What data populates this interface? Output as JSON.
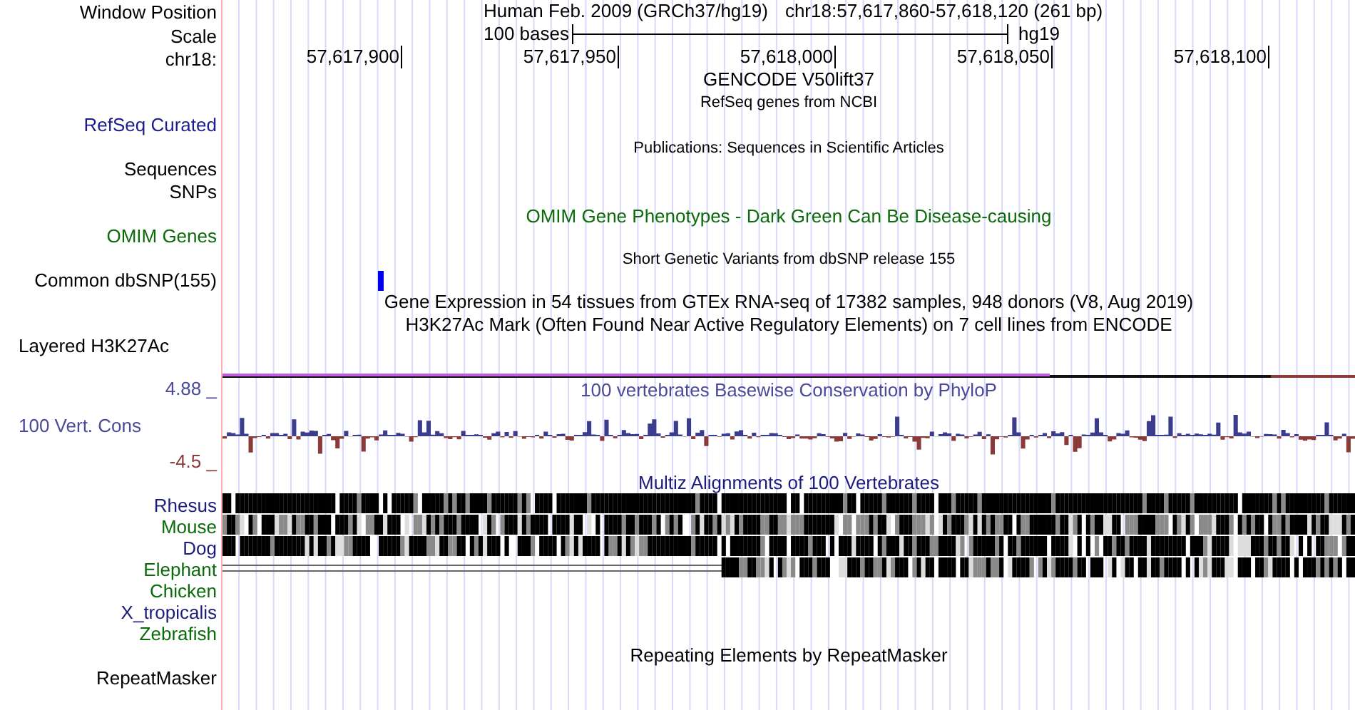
{
  "header": {
    "title": "Human Feb. 2009 (GRCh37/hg19)",
    "position": "chr18:57,617,860-57,618,120 (261 bp)",
    "scale_length": "100 bases",
    "assembly": "hg19",
    "ticks": [
      "57,617,900",
      "57,617,950",
      "57,618,000",
      "57,618,050",
      "57,618,100"
    ]
  },
  "labels": [
    {
      "text": "Window Position",
      "color": "#000000"
    },
    {
      "text": "Scale",
      "color": "#000000"
    },
    {
      "text": "chr18:",
      "color": "#000000"
    },
    {
      "text": "RefSeq Curated",
      "color": "#1c1c8c"
    },
    {
      "text": "Sequences",
      "color": "#000000"
    },
    {
      "text": "SNPs",
      "color": "#000000"
    },
    {
      "text": "OMIM Genes",
      "color": "#0b6b0b"
    },
    {
      "text": "Common dbSNP(155)",
      "color": "#000000"
    },
    {
      "text": "Layered H3K27Ac",
      "color": "#000000"
    },
    {
      "text": "4.88 _",
      "color": "#4a4a99"
    },
    {
      "text": "100 Vert. Cons",
      "color": "#4a4a99"
    },
    {
      "text": "-4.5 _",
      "color": "#8b3a3a"
    },
    {
      "text": "Rhesus",
      "color": "#1c1c7a"
    },
    {
      "text": "Mouse",
      "color": "#0b6b0b"
    },
    {
      "text": "Dog",
      "color": "#1c1c7a"
    },
    {
      "text": "Elephant",
      "color": "#0b6b0b"
    },
    {
      "text": "Chicken",
      "color": "#0b6b0b"
    },
    {
      "text": "X_tropicalis",
      "color": "#1c1c7a"
    },
    {
      "text": "Zebrafish",
      "color": "#0b6b0b"
    },
    {
      "text": "RepeatMasker",
      "color": "#000000"
    }
  ],
  "tracks": {
    "gencode": {
      "title": "GENCODE V50lift37",
      "subtitle": "RefSeq genes from NCBI"
    },
    "publications": {
      "title": "Publications: Sequences in Scientific Articles"
    },
    "omim": {
      "title": "OMIM Gene Phenotypes - Dark Green Can Be Disease-causing"
    },
    "dbsnp": {
      "title": "Short Genetic Variants from dbSNP release 155"
    },
    "gtex": {
      "title": "Gene Expression in 54 tissues from GTEx RNA-seq of 17382 samples, 948 donors (V8, Aug 2019)"
    },
    "h3k27ac": {
      "title": "H3K27Ac Mark (Often Found Near Active Regulatory Elements) on 7 cell lines from ENCODE"
    },
    "phylop": {
      "title": "100 vertebrates Basewise Conservation by PhyloP"
    },
    "multiz": {
      "title": "Multiz Alignments of 100 Vertebrates"
    },
    "repeatmasker": {
      "title": "Repeating Elements by RepeatMasker"
    }
  }
}
